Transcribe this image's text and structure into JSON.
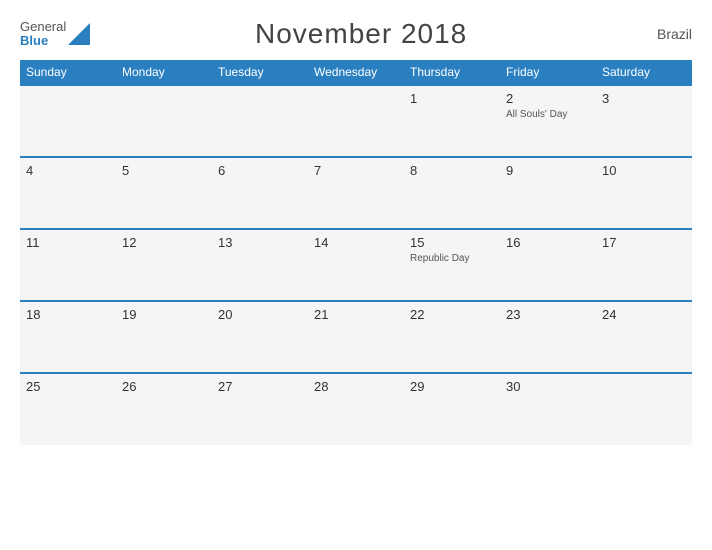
{
  "header": {
    "logo_general": "General",
    "logo_blue": "Blue",
    "title": "November 2018",
    "country": "Brazil"
  },
  "days_of_week": [
    "Sunday",
    "Monday",
    "Tuesday",
    "Wednesday",
    "Thursday",
    "Friday",
    "Saturday"
  ],
  "weeks": [
    [
      {
        "day": "",
        "holiday": ""
      },
      {
        "day": "",
        "holiday": ""
      },
      {
        "day": "",
        "holiday": ""
      },
      {
        "day": "",
        "holiday": ""
      },
      {
        "day": "1",
        "holiday": ""
      },
      {
        "day": "2",
        "holiday": "All Souls' Day"
      },
      {
        "day": "3",
        "holiday": ""
      }
    ],
    [
      {
        "day": "4",
        "holiday": ""
      },
      {
        "day": "5",
        "holiday": ""
      },
      {
        "day": "6",
        "holiday": ""
      },
      {
        "day": "7",
        "holiday": ""
      },
      {
        "day": "8",
        "holiday": ""
      },
      {
        "day": "9",
        "holiday": ""
      },
      {
        "day": "10",
        "holiday": ""
      }
    ],
    [
      {
        "day": "11",
        "holiday": ""
      },
      {
        "day": "12",
        "holiday": ""
      },
      {
        "day": "13",
        "holiday": ""
      },
      {
        "day": "14",
        "holiday": ""
      },
      {
        "day": "15",
        "holiday": "Republic Day"
      },
      {
        "day": "16",
        "holiday": ""
      },
      {
        "day": "17",
        "holiday": ""
      }
    ],
    [
      {
        "day": "18",
        "holiday": ""
      },
      {
        "day": "19",
        "holiday": ""
      },
      {
        "day": "20",
        "holiday": ""
      },
      {
        "day": "21",
        "holiday": ""
      },
      {
        "day": "22",
        "holiday": ""
      },
      {
        "day": "23",
        "holiday": ""
      },
      {
        "day": "24",
        "holiday": ""
      }
    ],
    [
      {
        "day": "25",
        "holiday": ""
      },
      {
        "day": "26",
        "holiday": ""
      },
      {
        "day": "27",
        "holiday": ""
      },
      {
        "day": "28",
        "holiday": ""
      },
      {
        "day": "29",
        "holiday": ""
      },
      {
        "day": "30",
        "holiday": ""
      },
      {
        "day": "",
        "holiday": ""
      }
    ]
  ]
}
